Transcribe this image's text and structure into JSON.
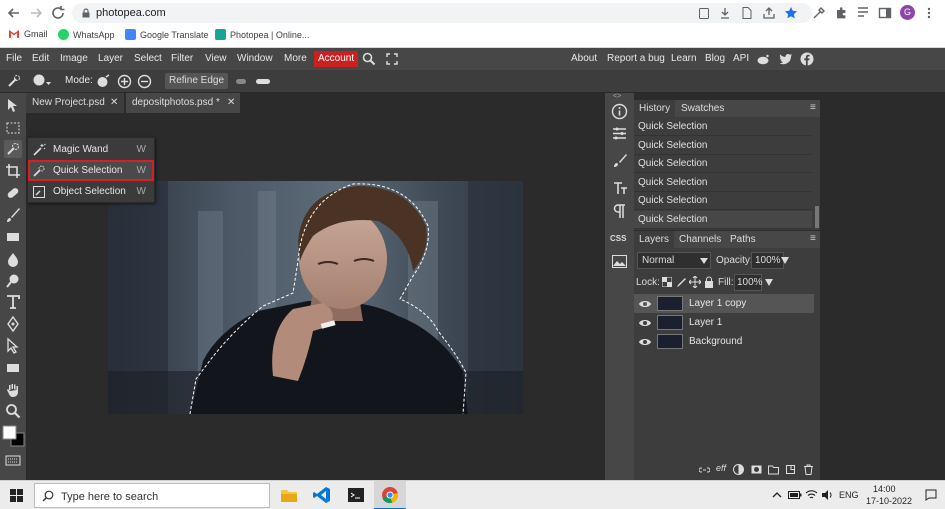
{
  "browser": {
    "url": "photopea.com",
    "bookmarks": [
      "Gmail",
      "WhatsApp",
      "Google Translate",
      "Photopea | Online..."
    ],
    "profile_initial": "G"
  },
  "menu": {
    "items": [
      "File",
      "Edit",
      "Image",
      "Layer",
      "Select",
      "Filter",
      "View",
      "Window",
      "More"
    ],
    "account": "Account",
    "right_items": [
      "About",
      "Report a bug",
      "Learn",
      "Blog",
      "API"
    ]
  },
  "options": {
    "mode_label": "Mode:",
    "refine_edge": "Refine Edge"
  },
  "tabs": [
    {
      "label": "New Project.psd",
      "close": "✕"
    },
    {
      "label": "depositphotos.psd *",
      "close": "✕"
    }
  ],
  "flyout": {
    "items": [
      {
        "label": "Magic Wand",
        "shortcut": "W",
        "icon": "magic-wand-icon"
      },
      {
        "label": "Quick Selection",
        "shortcut": "W",
        "icon": "quick-selection-icon",
        "selected": true
      },
      {
        "label": "Object Selection",
        "shortcut": "W",
        "icon": "object-selection-icon"
      }
    ]
  },
  "history": {
    "tabs": [
      "History",
      "Swatches"
    ],
    "entries": [
      "Quick Selection",
      "Quick Selection",
      "Quick Selection",
      "Quick Selection",
      "Quick Selection",
      "Quick Selection"
    ]
  },
  "layers": {
    "tabs": [
      "Layers",
      "Channels",
      "Paths"
    ],
    "blend_mode": "Normal",
    "opacity_label": "Opacity:",
    "opacity": "100%",
    "lock_label": "Lock:",
    "fill_label": "Fill:",
    "fill": "100%",
    "items": [
      {
        "name": "Layer 1 copy",
        "selected": true
      },
      {
        "name": "Layer 1",
        "selected": false
      },
      {
        "name": "Background",
        "selected": false
      }
    ]
  },
  "taskbar": {
    "search_placeholder": "Type here to search",
    "language": "ENG",
    "time": "14:00",
    "date": "17-10-2022"
  },
  "colors": {
    "account_red": "#cc1f1f",
    "highlight_red": "#d81f26",
    "panel_bg": "#3d3d3d",
    "workspace_bg": "#2b2b2b"
  }
}
